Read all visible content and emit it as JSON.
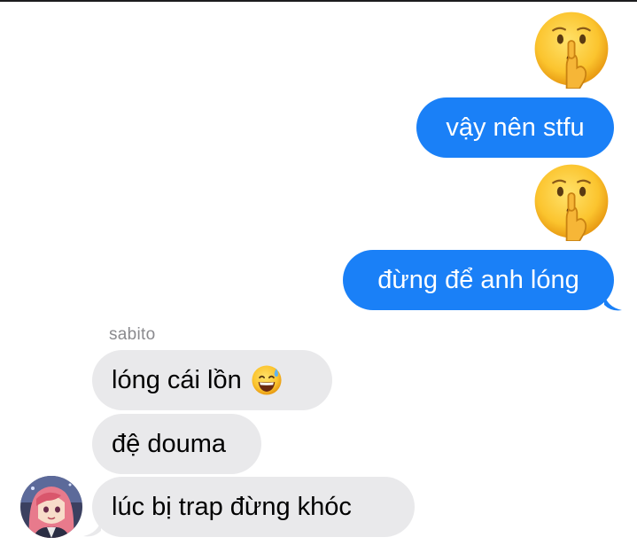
{
  "conversation": {
    "sent_messages": [
      {
        "type": "emoji",
        "emoji_name": "shushing-face-emoji"
      },
      {
        "type": "text",
        "text": "vậy nên stfu"
      },
      {
        "type": "emoji",
        "emoji_name": "shushing-face-emoji"
      },
      {
        "type": "text",
        "text": "đừng để anh lóng"
      }
    ],
    "received": {
      "sender": "sabito",
      "messages": [
        {
          "text": "lóng cái lồn",
          "emoji_name": "grinning-face-with-sweat-emoji"
        },
        {
          "text": "đệ douma"
        },
        {
          "text": "lúc bị trap đừng khóc"
        }
      ],
      "avatar_icon": "anime-avatar-icon"
    }
  },
  "colors": {
    "sent_bubble": "#1a80f7",
    "received_bubble": "#e9e9eb",
    "sender_name": "#8a8a8e"
  }
}
